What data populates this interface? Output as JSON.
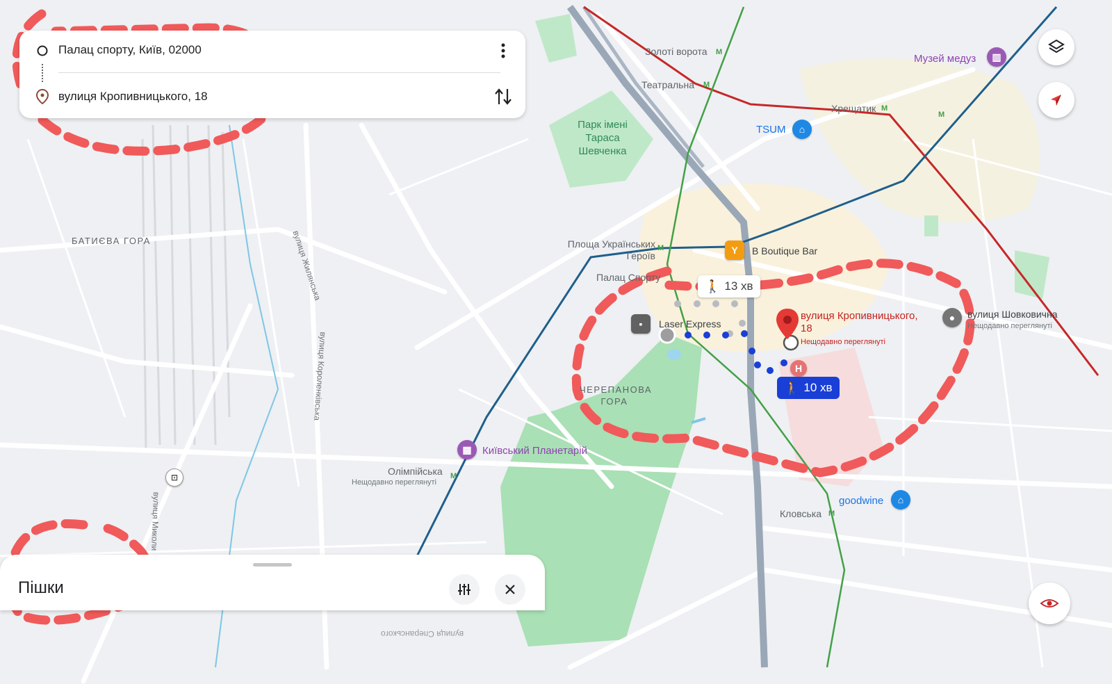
{
  "search": {
    "origin": "Палац спорту, Київ, 02000",
    "destination": "вулиця Кропивницького, 18"
  },
  "bottom_sheet": {
    "mode": "Пішки"
  },
  "chips": {
    "alt_route_time": "13 хв",
    "main_route_time": "10 хв"
  },
  "labels": {
    "zoloti_vorota": "Золоті ворота",
    "teatralna": "Театральна",
    "khreshchatyk": "Хрещатик",
    "muzei": "Музей медуз",
    "tsum": "TSUM",
    "park": "Парк імені Тараса Шевченка",
    "batyieva": "БАТИЄВА ГОРА",
    "ploshcha": "Площа Українських Героїв",
    "boutique": "B Boutique Bar",
    "palats_sportu": "Палац Спорту",
    "laser": "Laser Express",
    "dest_name": "вулиця Кропивницького, 18",
    "dest_sub": "Нещодавно переглянуті",
    "shovkovychna": "вулиця Шовковична",
    "shovkovychna_sub": "Нещодавно переглянуті",
    "cherepanova": "ЧЕРЕПАНОВА ГОРА",
    "planetarium": "Київський Планетарій",
    "olimpiiska": "Олімпійська",
    "olimpiiska_sub": "Нещодавно переглянуті",
    "klovska": "Кловська",
    "goodwine": "goodwine",
    "zhylianska": "вулиця Жилянська",
    "korolenkivska": "вулиця Короленківська",
    "mykoly": "вулиця Миколи",
    "bottom_road": "вулиця Сперанського"
  },
  "colors": {
    "metro_red": "#c62828",
    "metro_blue": "#1f5f8b",
    "metro_green": "#43a047",
    "route_blue": "#1a3fd6",
    "annotation_red": "#f05a5a",
    "park_green": "#b7e4c0"
  },
  "icons": {
    "layers": "layers-icon",
    "compass": "compass-icon",
    "eye": "street-view-icon",
    "more": "more-vert-icon",
    "swap": "swap-icon",
    "filter": "tune-icon",
    "close": "close-icon"
  }
}
